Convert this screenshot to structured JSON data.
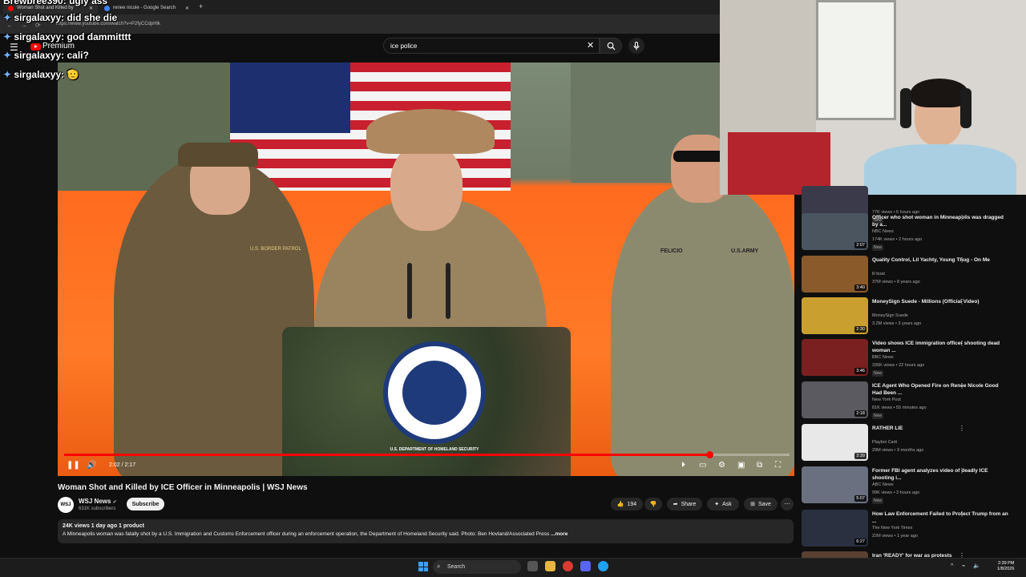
{
  "browser": {
    "tabs": [
      {
        "label": "Woman Shot and Killed by"
      },
      {
        "label": "renee nicole - Google Search"
      }
    ],
    "new_tab": "+",
    "url": "https://www.youtube.com/watch?v=P2fyCCdpHlk"
  },
  "youtube": {
    "premium_label": "Premium",
    "search_value": "ice police"
  },
  "chat": [
    {
      "user": "Brewbree390:",
      "text": "ugly ass"
    },
    {
      "user": "sirgalaxyy:",
      "text": "did she die"
    },
    {
      "user": "sirgalaxyy:",
      "text": "god dammitttt"
    },
    {
      "user": "sirgalaxyy:",
      "text": "cali?"
    },
    {
      "user": "sirgalaxyy:",
      "text": "🫡"
    }
  ],
  "player": {
    "time": "2:02 / 2:17",
    "progress": 0.89,
    "seal_text": "U.S. DEPARTMENT OF HOMELAND SECURITY",
    "patch_left": "U.S. BORDER PATROL",
    "name_right": "FELICIO",
    "tape_right": "U.S.ARMY"
  },
  "video": {
    "title": "Woman Shot and Killed by ICE Officer in Minneapolis | WSJ News",
    "channel": "WSJ News",
    "channel_avatar": "WSJ",
    "subscribers": "631K subscribers",
    "subscribe_label": "Subscribe",
    "likes": "194",
    "share_label": "Share",
    "ask_label": "Ask",
    "save_label": "Save",
    "description_meta": "24K views  1 day ago  1 product",
    "description": "A Minneapolis woman was fatally shot by a U.S. Immigration and Customs Enforcement officer during an enforcement operation, the Department of Homeland Security said. Photo: Ben Hovland/Associated Press",
    "more_label": "...more"
  },
  "recommended": [
    {
      "title": "",
      "channel": "",
      "meta": "77K views • 6 hours ago",
      "badge": "New",
      "duration": "3:46",
      "color": "#3a3a4a"
    },
    {
      "title": "Officer who shot woman in Minneapolis was dragged by a...",
      "channel": "NBC News",
      "meta": "174K views • 2 hours ago",
      "badge": "New",
      "duration": "2:07",
      "color": "#4a5560"
    },
    {
      "title": "Quality Control, Lil Yachty, Young Thug - On Me",
      "channel": "lil boat",
      "meta": "37M views • 8 years ago",
      "badge": "",
      "duration": "3:40",
      "color": "#8a5a2a"
    },
    {
      "title": "MoneySign Suede - Millions (Official Video)",
      "channel": "MoneySign Suede",
      "meta": "3.2M views • 3 years ago",
      "badge": "",
      "duration": "2:30",
      "color": "#c9a030"
    },
    {
      "title": "Video shows ICE immigration officer shooting dead woman ...",
      "channel": "BBC News",
      "meta": "336K views • 22 hours ago",
      "badge": "New",
      "duration": "3:46",
      "color": "#7a2020"
    },
    {
      "title": "ICE Agent Who Opened Fire on Renee Nicole Good Had Been ...",
      "channel": "New York Post",
      "meta": "81K views • 55 minutes ago",
      "badge": "New",
      "duration": "2:18",
      "color": "#5a5a60"
    },
    {
      "title": "RATHER LIE",
      "channel": "Playboi Carti",
      "meta": "29M views • 9 months ago",
      "badge": "",
      "duration": "3:39",
      "color": "#e8e8e8"
    },
    {
      "title": "Former FBI agent analyzes video of deadly ICE shooting i...",
      "channel": "ABC News",
      "meta": "99K views • 3 hours ago",
      "badge": "New",
      "duration": "5:07",
      "color": "#6a7080"
    },
    {
      "title": "How Law Enforcement Failed to Protect Trump from an ...",
      "channel": "The New York Times",
      "meta": "22M views • 1 year ago",
      "badge": "",
      "duration": "6:27",
      "color": "#2a3040"
    },
    {
      "title": "Iran 'READY' for war as protests",
      "channel": "",
      "meta": "",
      "badge": "",
      "duration": "",
      "color": "#5a4030"
    }
  ],
  "taskbar": {
    "search_label": "Search",
    "time": "2:39 PM",
    "date": "1/8/2026"
  },
  "colors": {
    "accent": "#ff0000",
    "background": "#0f0f0f",
    "surface": "#272727"
  }
}
